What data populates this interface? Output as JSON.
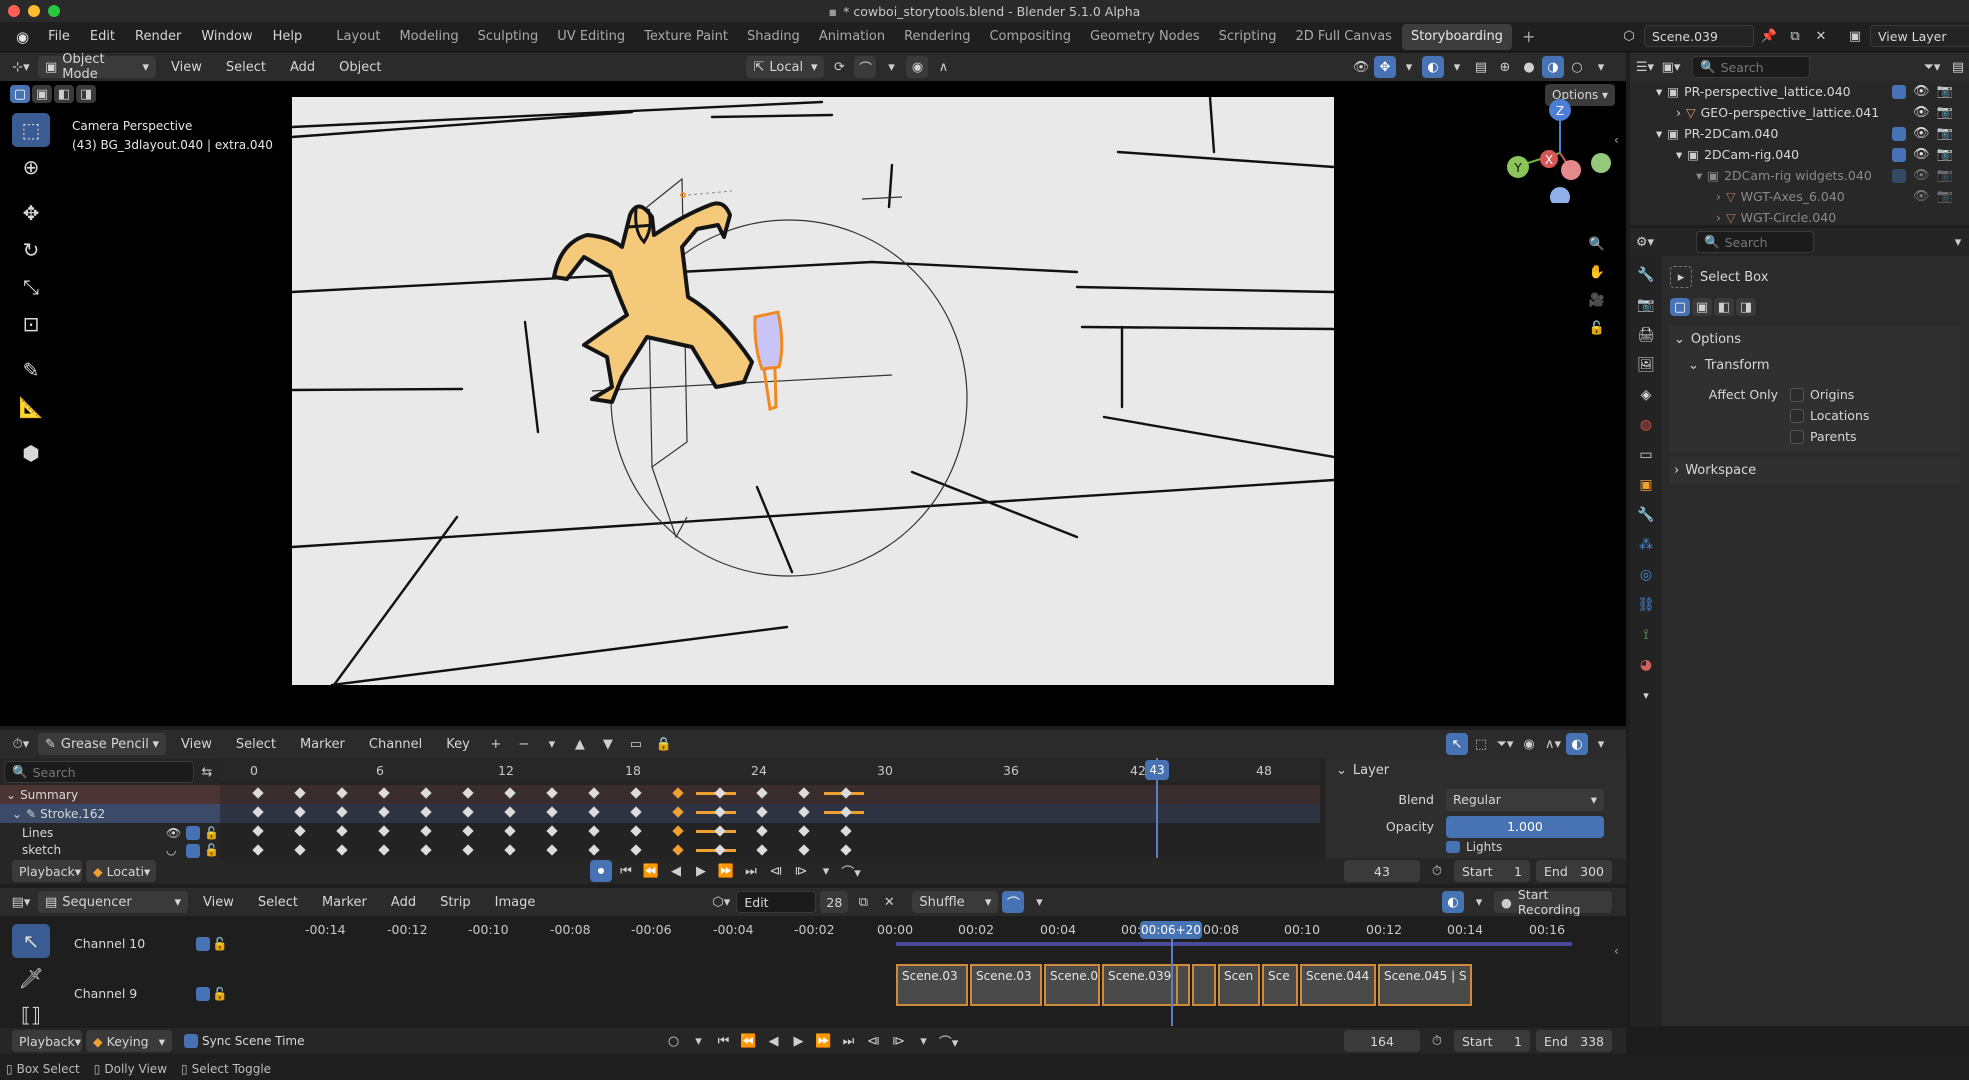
{
  "window": {
    "title": "* cowboi_storytools.blend - Blender 5.1.0 Alpha"
  },
  "menu": {
    "file": "File",
    "edit": "Edit",
    "render": "Render",
    "window": "Window",
    "help": "Help"
  },
  "workspaces": [
    "Layout",
    "Modeling",
    "Sculpting",
    "UV Editing",
    "Texture Paint",
    "Shading",
    "Animation",
    "Rendering",
    "Compositing",
    "Geometry Nodes",
    "Scripting",
    "2D Full Canvas",
    "Storyboarding"
  ],
  "scene": {
    "name": "Scene.039",
    "view_layer": "View Layer"
  },
  "viewport": {
    "mode": "Object Mode",
    "menus": [
      "View",
      "Select",
      "Add",
      "Object"
    ],
    "transform_orientation": "Local",
    "options_label": "Options",
    "overlay_title": "Camera Perspective",
    "overlay_subtitle": "(43) BG_3dlayout.040 | extra.040",
    "gizmo": {
      "z": "Z",
      "y": "Y",
      "x": "X"
    }
  },
  "outliner": {
    "search_placeholder": "Search",
    "items": [
      {
        "label": "PR-perspective_lattice.040"
      },
      {
        "label": "GEO-perspective_lattice.041"
      },
      {
        "label": "PR-2DCam.040"
      },
      {
        "label": "2DCam-rig.040"
      },
      {
        "label": "2DCam-rig widgets.040"
      },
      {
        "label": "WGT-Axes_6.040"
      },
      {
        "label": "WGT-Circle.040"
      }
    ]
  },
  "properties": {
    "search_placeholder": "Search",
    "tool_name": "Select Box",
    "options_panel": "Options",
    "transform_panel": "Transform",
    "affect_only_label": "Affect Only",
    "origins": "Origins",
    "locations": "Locations",
    "parents": "Parents",
    "workspace_panel": "Workspace"
  },
  "dopesheet": {
    "mode": "Grease Pencil",
    "menus": [
      "View",
      "Select",
      "Marker",
      "Channel",
      "Key"
    ],
    "search_placeholder": "Search",
    "channels": {
      "summary": "Summary",
      "stroke": "Stroke.162",
      "lines": "Lines",
      "sketch": "sketch"
    },
    "ruler": [
      "0",
      "6",
      "12",
      "18",
      "24",
      "30",
      "36",
      "42",
      "48"
    ],
    "current_frame": "43",
    "layer_panel": {
      "title": "Layer",
      "blend_label": "Blend",
      "blend_value": "Regular",
      "opacity_label": "Opacity",
      "opacity_value": "1.000",
      "lights_label": "Lights"
    },
    "playback": {
      "playback": "Playback",
      "keying": "Locati",
      "frame": "43",
      "start_label": "Start",
      "start": "1",
      "end_label": "End",
      "end": "300"
    }
  },
  "sequencer": {
    "mode": "Sequencer",
    "menus": [
      "View",
      "Select",
      "Marker",
      "Add",
      "Strip",
      "Image"
    ],
    "edit_label": "Edit",
    "edit_count": "28",
    "shuffle": "Shuffle",
    "start_recording": "Start Recording",
    "channels": [
      {
        "label": "Channel 10"
      },
      {
        "label": "Channel 9"
      }
    ],
    "ruler": [
      "-00:14",
      "-00:12",
      "-00:10",
      "-00:08",
      "-00:06",
      "-00:04",
      "-00:02",
      "00:00",
      "00:02",
      "00:04",
      "00:",
      "00:08",
      "00:10",
      "00:12",
      "00:14",
      "00:16"
    ],
    "current_time": "00:06+20",
    "strips": [
      "Scene.03",
      "Scene.03",
      "Scene.0",
      "Scene.039",
      "",
      "",
      "Scen",
      "Sce",
      "Scene.044",
      "Scene.045 | S"
    ],
    "playback": {
      "playback": "Playback",
      "keying": "Keying",
      "sync": "Sync Scene Time",
      "frame": "164",
      "start_label": "Start",
      "start": "1",
      "end_label": "End",
      "end": "338"
    }
  },
  "statusbar": {
    "box_select": "Box Select",
    "dolly_view": "Dolly View",
    "select_toggle": "Select Toggle"
  }
}
